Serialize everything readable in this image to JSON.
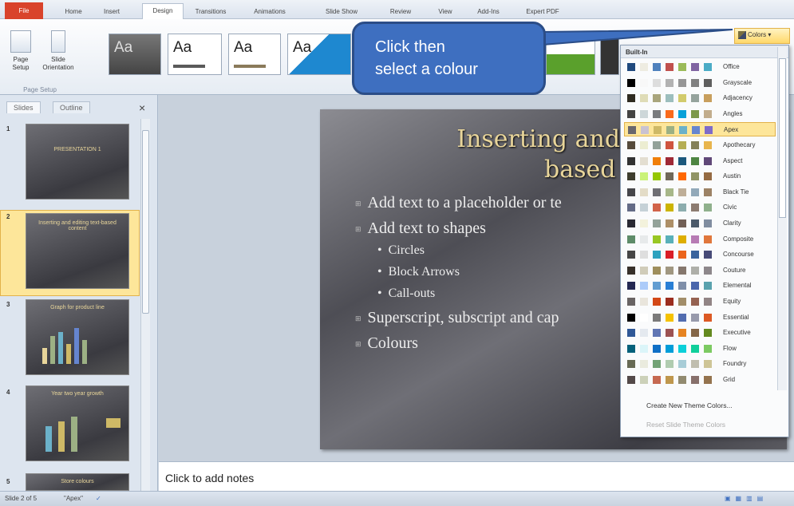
{
  "tabs": [
    "File",
    "Home",
    "Insert",
    "Design",
    "Transitions",
    "Animations",
    "Slide Show",
    "Review",
    "View",
    "Add-Ins",
    "Expert PDF"
  ],
  "ribbon": {
    "page_setup": "Page Setup",
    "slide_orientation": "Slide Orientation",
    "group_label": "Page Setup",
    "theme_sample": "Aa",
    "colors_button": "Colors"
  },
  "callout": {
    "line1": "Click then",
    "line2": "select a colour"
  },
  "left_pane": {
    "tab_slides": "Slides",
    "tab_outline": "Outline",
    "close": "×",
    "thumbs": [
      {
        "num": "1",
        "title": "PRESENTATION 1"
      },
      {
        "num": "2",
        "title": "Inserting and editing text-based content"
      },
      {
        "num": "3",
        "title": "Graph for product line"
      },
      {
        "num": "4",
        "title": "Year two year growth"
      },
      {
        "num": "5",
        "title": "Store colours"
      }
    ]
  },
  "slide": {
    "title1": "Inserting and editi",
    "title2": "based conte",
    "bullets": [
      "Add text to a placeholder or te",
      "Add text to shapes",
      "Circles",
      "Block Arrows",
      "Call-outs",
      "Superscript, subscript and cap",
      "Colours"
    ]
  },
  "notes_placeholder": "Click to add notes",
  "status": {
    "slide": "Slide 2 of 5",
    "theme": "\"Apex\""
  },
  "colors_dropdown": {
    "header": "Built-In",
    "items": [
      {
        "name": "Office",
        "colors": [
          "#1f497d",
          "#eeece1",
          "#4f81bd",
          "#c0504d",
          "#9bbb59",
          "#8064a2",
          "#4bacc6"
        ]
      },
      {
        "name": "Grayscale",
        "colors": [
          "#000000",
          "#f8f8f8",
          "#dddddd",
          "#b2b2b2",
          "#969696",
          "#808080",
          "#5f5f5f"
        ]
      },
      {
        "name": "Adjacency",
        "colors": [
          "#2f2b20",
          "#dfdcb7",
          "#a9a57c",
          "#9cbebd",
          "#d2cb6c",
          "#95a39d",
          "#c89f5d"
        ]
      },
      {
        "name": "Angles",
        "colors": [
          "#434342",
          "#cdd7d9",
          "#797b7e",
          "#f96a1b",
          "#08a1d9",
          "#7c984a",
          "#c2ad8d"
        ]
      },
      {
        "name": "Apex",
        "colors": [
          "#69676d",
          "#c9c2d1",
          "#ceb966",
          "#9cb084",
          "#6bb1c9",
          "#6585cf",
          "#7e6bc9"
        ]
      },
      {
        "name": "Apothecary",
        "colors": [
          "#564b3c",
          "#ecedd1",
          "#93a299",
          "#cf543f",
          "#b5ae53",
          "#848058",
          "#e8b54d"
        ]
      },
      {
        "name": "Aspect",
        "colors": [
          "#323232",
          "#e3ded1",
          "#f07f09",
          "#9f2936",
          "#1b587c",
          "#4e8542",
          "#604878"
        ]
      },
      {
        "name": "Austin",
        "colors": [
          "#3e3d2d",
          "#caf278",
          "#94c600",
          "#71685a",
          "#ff6700",
          "#909465",
          "#956b43"
        ]
      },
      {
        "name": "Black Tie",
        "colors": [
          "#46464a",
          "#e3dcc7",
          "#6f6f74",
          "#a7b789",
          "#beae98",
          "#92a9b9",
          "#9c8265"
        ]
      },
      {
        "name": "Civic",
        "colors": [
          "#646b86",
          "#c5d1d7",
          "#d16349",
          "#ccb400",
          "#8cadae",
          "#8c7b70",
          "#8fb08c"
        ]
      },
      {
        "name": "Clarity",
        "colors": [
          "#292934",
          "#f3f2dc",
          "#93a299",
          "#ad8f67",
          "#726056",
          "#4c5a6a",
          "#808da0"
        ]
      },
      {
        "name": "Composite",
        "colors": [
          "#5e8c69",
          "#e7eaeb",
          "#98c723",
          "#59b0b9",
          "#deae00",
          "#b77bb4",
          "#e0773c"
        ]
      },
      {
        "name": "Concourse",
        "colors": [
          "#464646",
          "#dedede",
          "#2da2bf",
          "#da1f28",
          "#eb641b",
          "#39639d",
          "#474b78"
        ]
      },
      {
        "name": "Couture",
        "colors": [
          "#37302a",
          "#d0ccb9",
          "#9e8e5c",
          "#a09781",
          "#85776d",
          "#aeafa9",
          "#8d878b"
        ]
      },
      {
        "name": "Elemental",
        "colors": [
          "#242852",
          "#accbf9",
          "#629dd1",
          "#297fd5",
          "#7f8fa9",
          "#4a66ac",
          "#5aa2ae"
        ]
      },
      {
        "name": "Equity",
        "colors": [
          "#696464",
          "#e9e5dc",
          "#d34817",
          "#9b2d1f",
          "#a28e6a",
          "#956251",
          "#918485"
        ]
      },
      {
        "name": "Essential",
        "colors": [
          "#000000",
          "#ffffff",
          "#7a7a7a",
          "#f5c201",
          "#526db0",
          "#989aac",
          "#dc5924"
        ]
      },
      {
        "name": "Executive",
        "colors": [
          "#2f5897",
          "#e4e9ef",
          "#6076b4",
          "#9c5252",
          "#e68422",
          "#846648",
          "#63891f"
        ]
      },
      {
        "name": "Flow",
        "colors": [
          "#04617b",
          "#dbf5f9",
          "#0f6fc6",
          "#009dd9",
          "#0bd0d9",
          "#10cf9b",
          "#7cca62"
        ]
      },
      {
        "name": "Foundry",
        "colors": [
          "#676a55",
          "#eaebde",
          "#72a376",
          "#b0ccb0",
          "#a8cdd7",
          "#c0beaf",
          "#cec597"
        ]
      },
      {
        "name": "Grid",
        "colors": [
          "#534949",
          "#ccd1b9",
          "#c66951",
          "#bf974d",
          "#928b70",
          "#87706b",
          "#94734e"
        ]
      }
    ],
    "create_new": "Create New Theme Colors...",
    "reset": "Reset Slide Theme Colors"
  }
}
